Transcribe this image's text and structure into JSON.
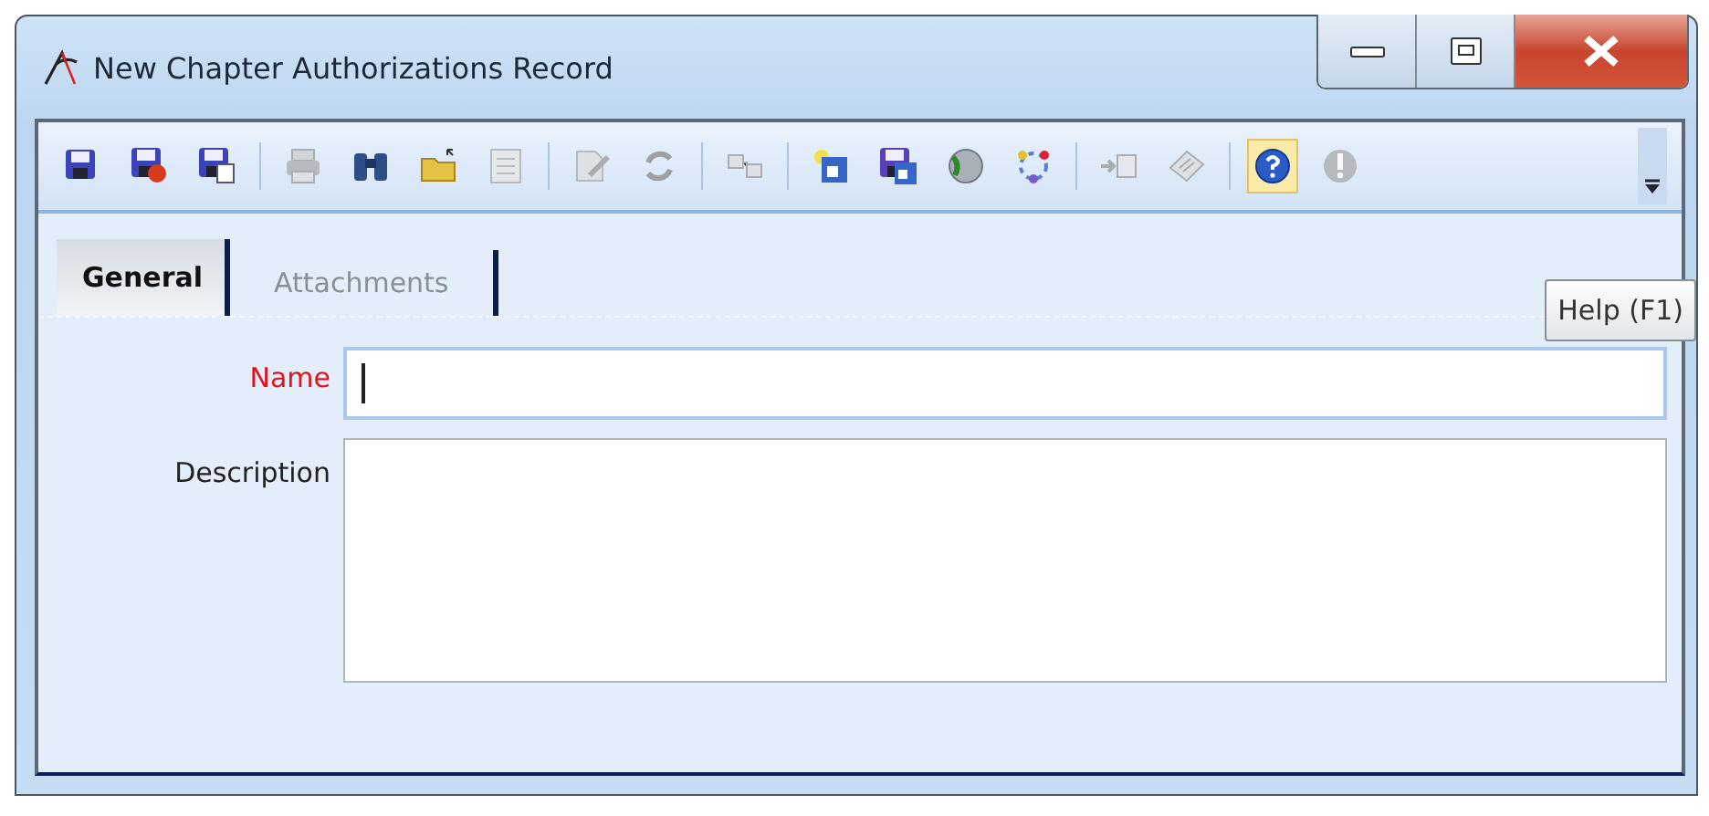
{
  "window": {
    "title": "New Chapter Authorizations Record"
  },
  "toolbar": [
    {
      "kind": "save",
      "disabled": false,
      "highlighted": false
    },
    {
      "kind": "save-close",
      "disabled": false,
      "highlighted": false
    },
    {
      "kind": "save-new",
      "disabled": false,
      "highlighted": false
    },
    {
      "kind": "separator"
    },
    {
      "kind": "print",
      "disabled": true,
      "highlighted": false
    },
    {
      "kind": "find",
      "disabled": false,
      "highlighted": false
    },
    {
      "kind": "open",
      "disabled": false,
      "highlighted": false
    },
    {
      "kind": "list",
      "disabled": true,
      "highlighted": false
    },
    {
      "kind": "separator"
    },
    {
      "kind": "edit",
      "disabled": true,
      "highlighted": false
    },
    {
      "kind": "refresh",
      "disabled": true,
      "highlighted": false
    },
    {
      "kind": "separator"
    },
    {
      "kind": "link",
      "disabled": true,
      "highlighted": false
    },
    {
      "kind": "separator"
    },
    {
      "kind": "new-window",
      "disabled": false,
      "highlighted": false
    },
    {
      "kind": "save-copy",
      "disabled": false,
      "highlighted": false
    },
    {
      "kind": "globe",
      "disabled": false,
      "highlighted": false
    },
    {
      "kind": "cycle",
      "disabled": false,
      "highlighted": false
    },
    {
      "kind": "separator"
    },
    {
      "kind": "import",
      "disabled": true,
      "highlighted": false
    },
    {
      "kind": "notes",
      "disabled": true,
      "highlighted": false
    },
    {
      "kind": "separator"
    },
    {
      "kind": "help",
      "disabled": false,
      "highlighted": true
    },
    {
      "kind": "warning",
      "disabled": true,
      "highlighted": false
    },
    {
      "kind": "overflow"
    }
  ],
  "tabs": [
    {
      "label": "General",
      "selected": true
    },
    {
      "label": "Attachments",
      "selected": false
    }
  ],
  "form": [
    {
      "kind": "line",
      "label": "Name",
      "required": true,
      "focused": true
    },
    {
      "kind": "multiline",
      "label": "Description",
      "required": false,
      "focused": false
    }
  ],
  "tooltip": {
    "text": "Help (F1)"
  }
}
